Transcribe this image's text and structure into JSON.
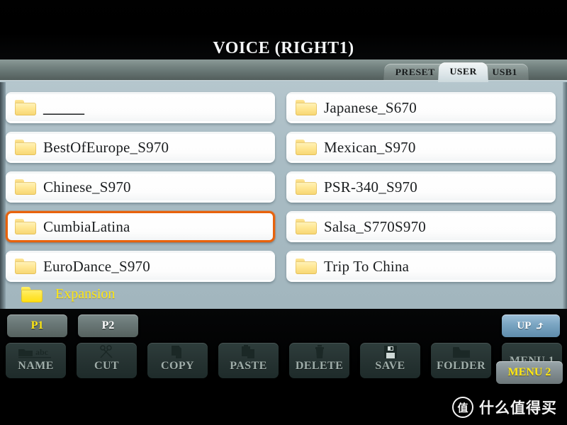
{
  "window": {
    "title": "VOICE (RIGHT1)"
  },
  "tabs": [
    {
      "label": "PRESET",
      "active": false
    },
    {
      "label": "USER",
      "active": true
    },
    {
      "label": "USB1",
      "active": false
    }
  ],
  "file_browser": {
    "selected": "CumbiaLatina",
    "columns": [
      {
        "items": [
          {
            "name": "______",
            "icon": "folder-icon",
            "selected": false,
            "blank": true
          },
          {
            "name": "BestOfEurope_S970",
            "icon": "folder-icon",
            "selected": false
          },
          {
            "name": "Chinese_S970",
            "icon": "folder-icon",
            "selected": false
          },
          {
            "name": "CumbiaLatina",
            "icon": "folder-icon",
            "selected": true
          },
          {
            "name": "EuroDance_S970",
            "icon": "folder-icon",
            "selected": false
          }
        ]
      },
      {
        "items": [
          {
            "name": "Japanese_S670",
            "icon": "folder-icon",
            "selected": false
          },
          {
            "name": "Mexican_S970",
            "icon": "folder-icon",
            "selected": false
          },
          {
            "name": "PSR-340_S970",
            "icon": "folder-icon",
            "selected": false
          },
          {
            "name": "Salsa_S770S970",
            "icon": "folder-icon",
            "selected": false
          },
          {
            "name": "Trip To China",
            "icon": "folder-icon",
            "selected": false
          }
        ]
      }
    ],
    "expansion": {
      "label": "Expansion",
      "icon": "folder-icon",
      "color": "#ffe815"
    }
  },
  "pager": {
    "pages": [
      {
        "label": "P1",
        "active": true
      },
      {
        "label": "P2",
        "active": false
      }
    ],
    "up": {
      "label": "UP",
      "icon": "up-arrow-icon"
    }
  },
  "toolbar": {
    "buttons": [
      {
        "label": "NAME",
        "icon": "folder-abc-icon"
      },
      {
        "label": "CUT",
        "icon": "scissors-icon"
      },
      {
        "label": "COPY",
        "icon": "copy-documents-icon"
      },
      {
        "label": "PASTE",
        "icon": "clipboard-paste-icon"
      },
      {
        "label": "DELETE",
        "icon": "trash-icon"
      },
      {
        "label": "SAVE",
        "icon": "floppy-disk-icon"
      },
      {
        "label": "FOLDER",
        "icon": "folder-icon"
      },
      {
        "label": "MENU 1",
        "icon": "menu-icon"
      }
    ],
    "menu_overlay": {
      "label": "MENU 2",
      "color": "#ffe815"
    }
  },
  "watermark": {
    "logo_char": "值",
    "text": "什么值得买"
  },
  "colors": {
    "selection": "#e8620c",
    "panel_bg": "#a9bcc4",
    "accent_yellow": "#ffe815",
    "up_button": "#7aa5c2"
  }
}
